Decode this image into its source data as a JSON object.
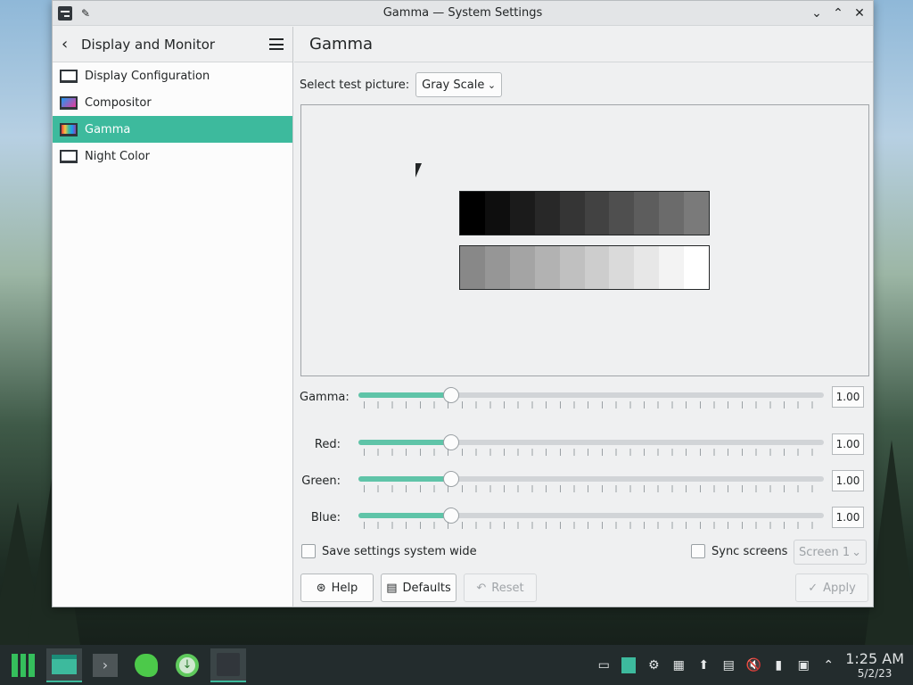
{
  "window": {
    "title": "Gamma — System Settings"
  },
  "sidebar": {
    "title": "Display and Monitor",
    "items": [
      {
        "label": "Display Configuration"
      },
      {
        "label": "Compositor"
      },
      {
        "label": "Gamma"
      },
      {
        "label": "Night Color"
      }
    ]
  },
  "main": {
    "header": "Gamma",
    "test_picture": {
      "label": "Select test picture:",
      "value": "Gray Scale"
    },
    "dark_shades": [
      "#000000",
      "#0e0e0e",
      "#1b1b1b",
      "#282828",
      "#353535",
      "#424242",
      "#4f4f4f",
      "#5d5d5d",
      "#6b6b6b",
      "#7a7a7a"
    ],
    "light_shades": [
      "#888888",
      "#969696",
      "#a4a4a4",
      "#b2b2b2",
      "#c0c0c0",
      "#cdcdcd",
      "#dadada",
      "#e7e7e7",
      "#f3f3f3",
      "#ffffff"
    ],
    "sliders": [
      {
        "label": "Gamma:",
        "value": "1.00",
        "fraction": 0.2
      },
      {
        "label": "Red:",
        "value": "1.00",
        "fraction": 0.2
      },
      {
        "label": "Green:",
        "value": "1.00",
        "fraction": 0.2
      },
      {
        "label": "Blue:",
        "value": "1.00",
        "fraction": 0.2
      }
    ],
    "save_system_wide": "Save settings system wide",
    "sync_screens": "Sync screens",
    "screen_select": "Screen 1",
    "buttons": {
      "help": "Help",
      "defaults": "Defaults",
      "reset": "Reset",
      "apply": "Apply"
    }
  },
  "taskbar": {
    "time": "1:25 AM",
    "date": "5/2/23"
  },
  "colors": {
    "accent": "#3dba9d",
    "slider_fill": "#5fc4a8"
  }
}
